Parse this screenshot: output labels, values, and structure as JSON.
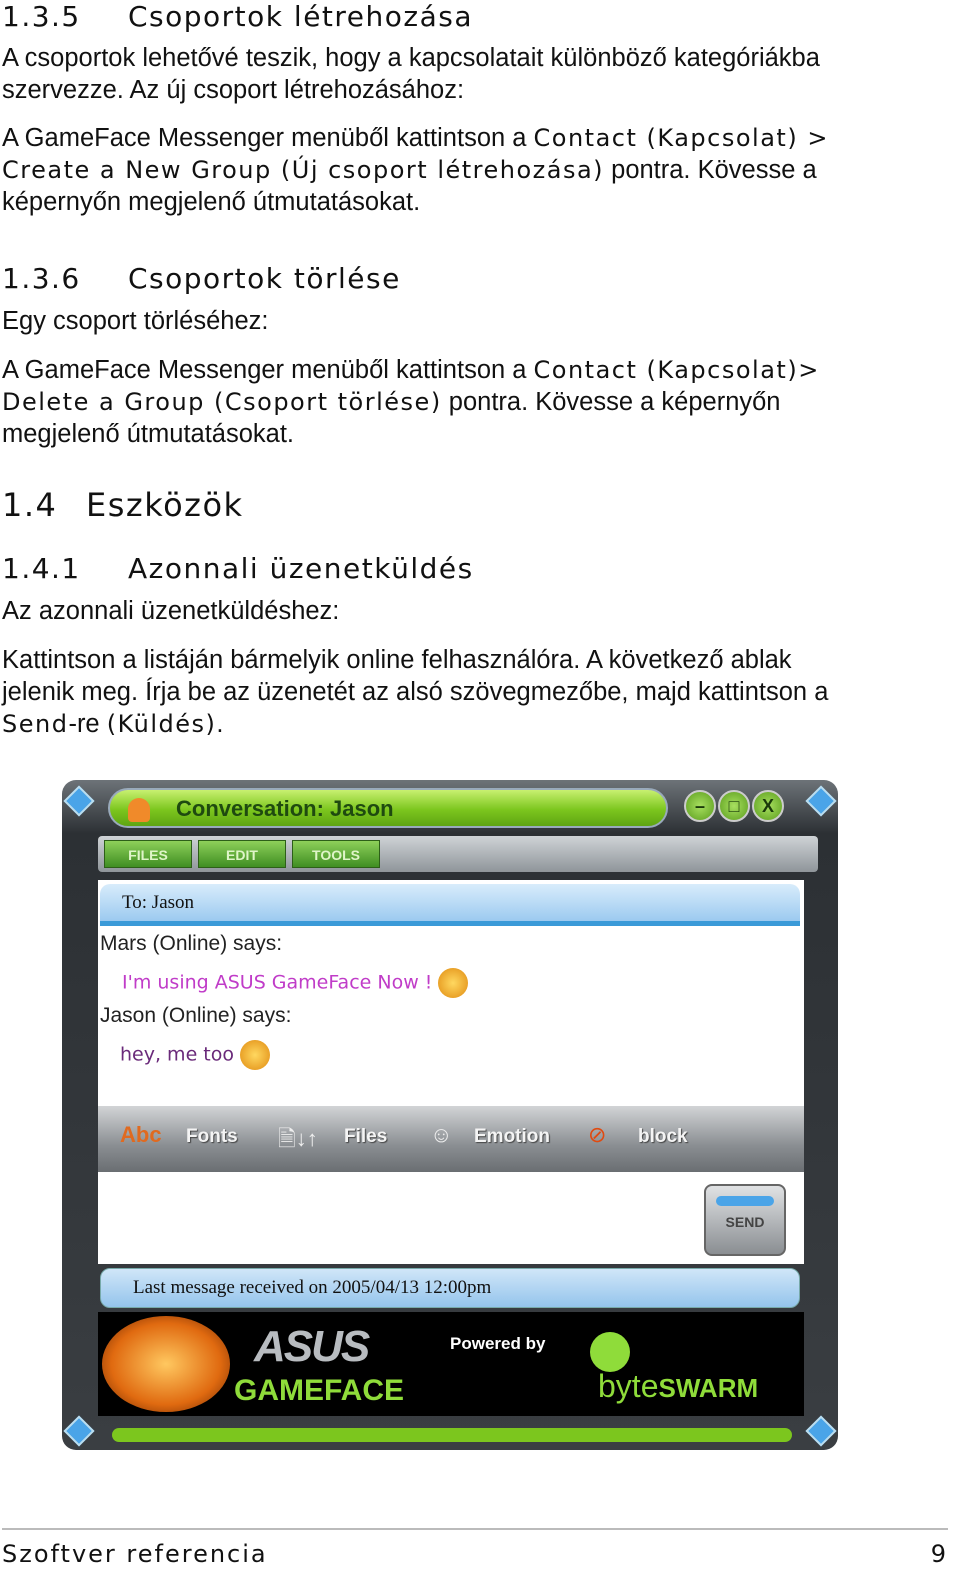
{
  "s135": {
    "num": "1.3.5",
    "title": "Csoportok létrehozása",
    "p1a": "A csoportok lehetővé teszik, hogy a kapcsolatait különböző kategóriákba",
    "p1b": "szervezze. Az új csoport létrehozásához:",
    "p2a": "A GameFace Messenger menüből kattintson a ",
    "p2cmd1": "Contact (Kapcsolat) >",
    "p2cmd2": "Create a New Group (Új csoport létrehozása)",
    "p2b": " pontra. Kövesse a",
    "p2c": "képernyőn megjelenő útmutatásokat."
  },
  "s136": {
    "num": "1.3.6",
    "title": "Csoportok törlése",
    "p1": "Egy csoport törléséhez:",
    "p2a": "A GameFace Messenger menüből kattintson a ",
    "p2cmd1": "Contact (Kapcsolat)>",
    "p2cmd2": "Delete a Group (Csoport törlése)",
    "p2b": " pontra. Kövesse a képernyőn",
    "p2c": "megjelenő útmutatásokat."
  },
  "s14": {
    "num": "1.4",
    "title": "Eszközök"
  },
  "s141": {
    "num": "1.4.1",
    "title": "Azonnali üzenetküldés",
    "p1": "Az azonnali üzenetküldéshez:",
    "p2a": "Kattintson a listáján bármelyik online felhasználóra. A következő ablak",
    "p2b": "jelenik meg. Írja be az üzenetét az alsó szövegmezőbe, majd kattintson a",
    "p2cmd1": "Send",
    "p2c": "-re ",
    "p2cmd2": "(Küldés)",
    "p2d": "."
  },
  "window": {
    "title": "Conversation: Jason",
    "minimize": "–",
    "maximize": "□",
    "close": "X",
    "menus": [
      "FILES",
      "EDIT",
      "TOOLS"
    ],
    "to": "To: Jason",
    "messages": [
      {
        "sender": "Mars (Online) says:",
        "text": "I'm using ASUS GameFace Now !",
        "color": "#c03cc8",
        "emoticon": "grin-icon"
      },
      {
        "sender": "Jason (Online) says:",
        "text": "hey, me too",
        "color": "#6a2a7a",
        "emoticon": "laugh-cry-icon"
      }
    ],
    "tools": [
      "Fonts",
      "Files",
      "Emotion",
      "block"
    ],
    "send": "SEND",
    "status": "Last message received on 2005/04/13 12:00pm",
    "banner": {
      "asus": "ASUS",
      "gameface": "GAMEFACE",
      "powered": "Powered by",
      "byte": "byte",
      "swarm": "SWARM"
    }
  },
  "footer": {
    "text": "Szoftver referencia",
    "page": "9"
  }
}
